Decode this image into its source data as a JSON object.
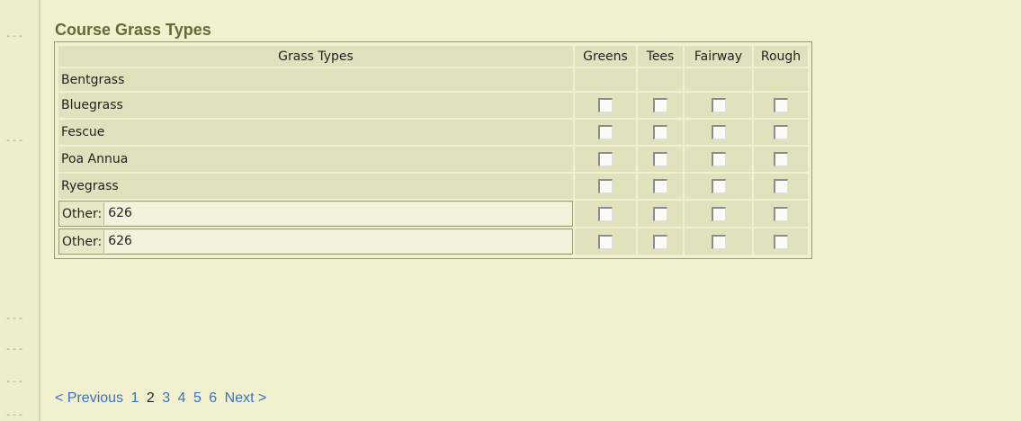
{
  "section": {
    "title": "Course Grass Types"
  },
  "table": {
    "headers": {
      "grass_types": "Grass Types",
      "greens": "Greens",
      "tees": "Tees",
      "fairway": "Fairway",
      "rough": "Rough"
    },
    "rows": [
      {
        "name": "Bentgrass",
        "checkable": false
      },
      {
        "name": "Bluegrass",
        "checkable": true,
        "greens": false,
        "tees": false,
        "fairway": false,
        "rough": false
      },
      {
        "name": "Fescue",
        "checkable": true,
        "greens": false,
        "tees": false,
        "fairway": false,
        "rough": false
      },
      {
        "name": "Poa Annua",
        "checkable": true,
        "greens": false,
        "tees": false,
        "fairway": false,
        "rough": false
      },
      {
        "name": "Ryegrass",
        "checkable": true,
        "greens": false,
        "tees": false,
        "fairway": false,
        "rough": false
      }
    ],
    "other_rows": [
      {
        "label": "Other:",
        "value": "626",
        "greens": false,
        "tees": false,
        "fairway": false,
        "rough": false
      },
      {
        "label": "Other:",
        "value": "626",
        "greens": false,
        "tees": false,
        "fairway": false,
        "rough": false
      }
    ]
  },
  "rail": {
    "dash": "---"
  },
  "pager": {
    "previous": "< Previous",
    "pages": [
      "1",
      "2",
      "3",
      "4",
      "5",
      "6"
    ],
    "current": "2",
    "next": "Next >"
  },
  "colors": {
    "background": "#f1f0cf",
    "cell": "#e2e1be",
    "title": "#696936",
    "link": "#3d73b8"
  }
}
